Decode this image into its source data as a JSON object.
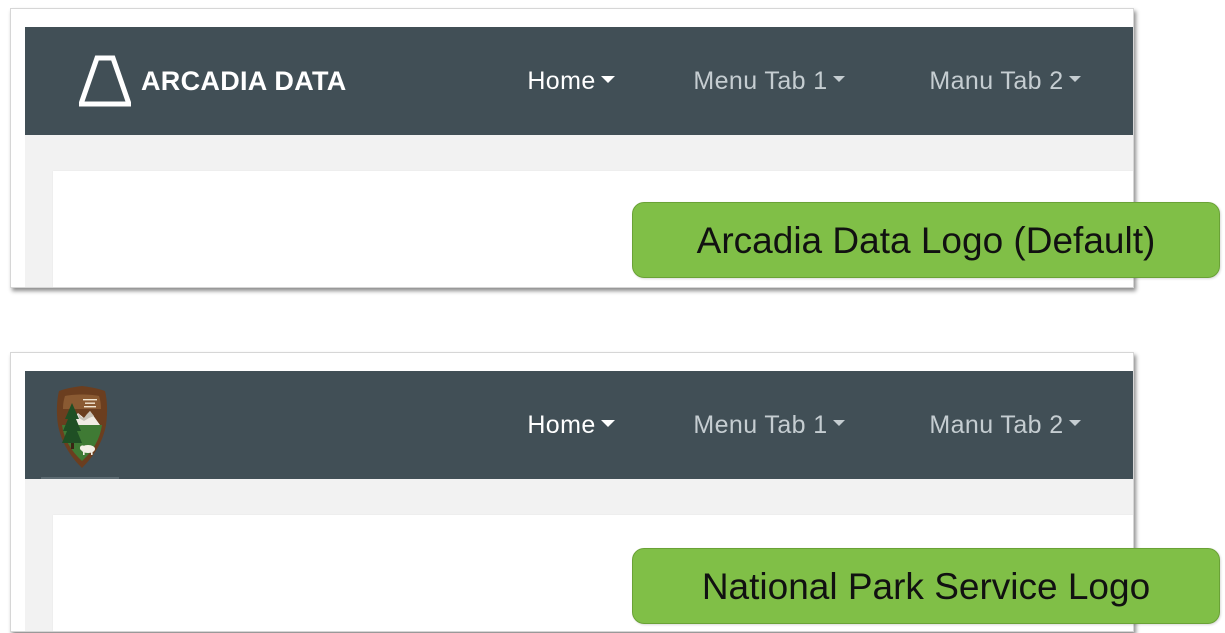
{
  "panel_default": {
    "logo_text": "ARCADIA DATA",
    "callout": "Arcadia Data Logo (Default)"
  },
  "panel_custom": {
    "callout": "National Park Service Logo"
  },
  "nav": {
    "tabs": [
      {
        "label": "Home",
        "active": true
      },
      {
        "label": "Menu Tab 1",
        "active": false
      },
      {
        "label": "Manu Tab 2",
        "active": false
      }
    ]
  },
  "icons": {
    "arcadia_logo": "arcadia-logo-icon",
    "nps_logo": "national-park-service-logo-icon",
    "dropdown": "caret-down-icon"
  },
  "colors": {
    "navbar": "#414f56",
    "active_tab_indicator": "#7b8b92",
    "callout": "#80bf47",
    "content_background": "#f2f2f2"
  }
}
